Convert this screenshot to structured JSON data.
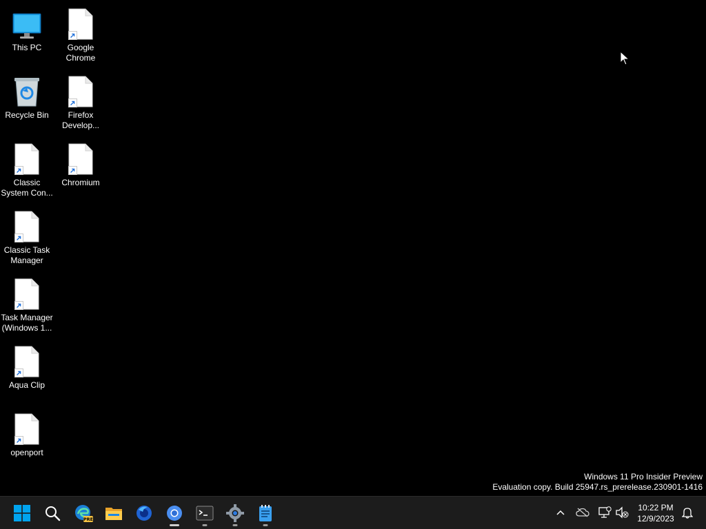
{
  "desktop": {
    "icons": [
      {
        "label": "This PC"
      },
      {
        "label": "Google Chrome"
      },
      {
        "label": "Recycle Bin"
      },
      {
        "label": "Firefox Develop..."
      },
      {
        "label": "Classic System Con..."
      },
      {
        "label": "Chromium"
      },
      {
        "label": "Classic Task Manager"
      },
      {
        "label": "Task Manager (Windows 1..."
      },
      {
        "label": "Aqua Clip"
      },
      {
        "label": "openport"
      }
    ]
  },
  "watermark": {
    "line1": "Windows 11 Pro Insider Preview",
    "line2": "Evaluation copy. Build 25947.rs_prerelease.230901-1416"
  },
  "taskbar": {
    "apps": [
      {
        "icon": "windows-start-icon"
      },
      {
        "icon": "search-icon"
      },
      {
        "icon": "edge-preview-icon",
        "badge": "PRE"
      },
      {
        "icon": "file-explorer-icon"
      },
      {
        "icon": "firefox-developer-icon"
      },
      {
        "icon": "chromium-icon"
      },
      {
        "icon": "terminal-icon"
      },
      {
        "icon": "settings-icon"
      },
      {
        "icon": "notepad-icon"
      }
    ],
    "tray": {
      "time": "10:22 PM",
      "date": "12/9/2023"
    }
  },
  "colors": {
    "taskbar_bg": "#1c1c1c",
    "accent_blue": "#0078d4",
    "desktop_bg": "#000000"
  }
}
